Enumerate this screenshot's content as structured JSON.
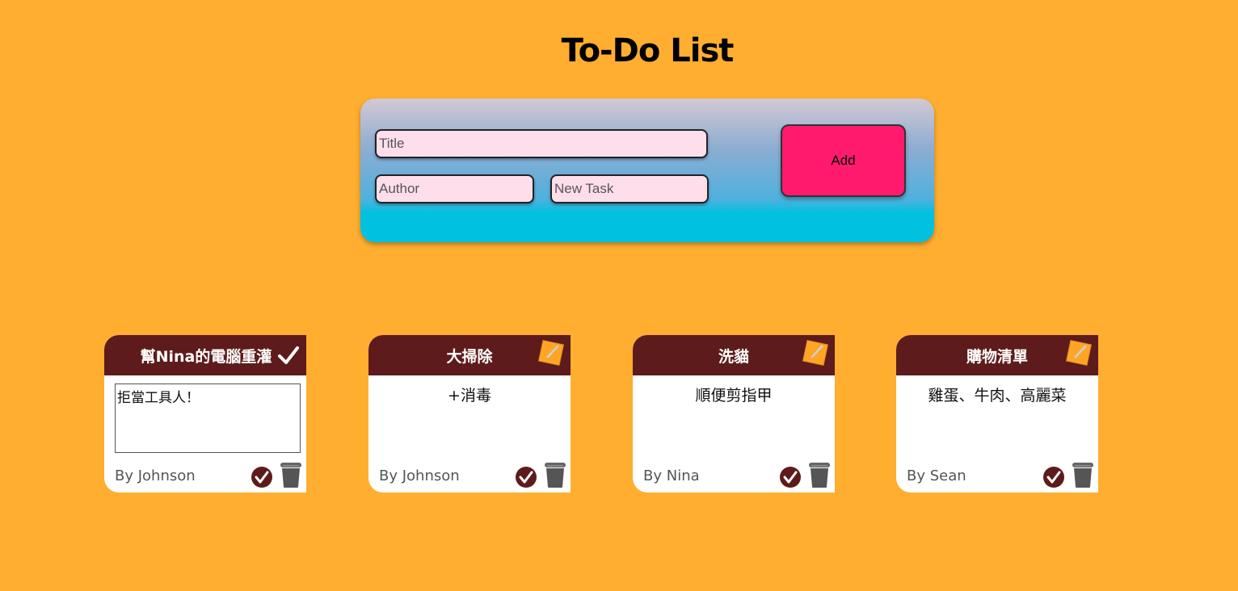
{
  "header": {
    "title": "To-Do List"
  },
  "form": {
    "title_placeholder": "Title",
    "author_placeholder": "Author",
    "task_placeholder": "New Task",
    "add_label": "Add"
  },
  "cards": [
    {
      "title": "幫Nina的電腦重灌",
      "task": "拒當工具人！",
      "author": "By Johnson",
      "state": "editing",
      "header_icon": "check-icon"
    },
    {
      "title": "大掃除",
      "task": "+消毒",
      "author": "By Johnson",
      "state": "view",
      "header_icon": "edit-icon"
    },
    {
      "title": "洗貓",
      "task": "順便剪指甲",
      "author": "By Nina",
      "state": "view",
      "header_icon": "edit-icon"
    },
    {
      "title": "購物清單",
      "task": "雞蛋、牛肉、高麗菜",
      "author": "By Sean",
      "state": "view",
      "header_icon": "edit-icon"
    }
  ],
  "colors": {
    "background": "#ffae30",
    "card_header": "#5e1b1b",
    "add_button": "#ff1a6e",
    "input_fill": "#ffdeeb"
  }
}
